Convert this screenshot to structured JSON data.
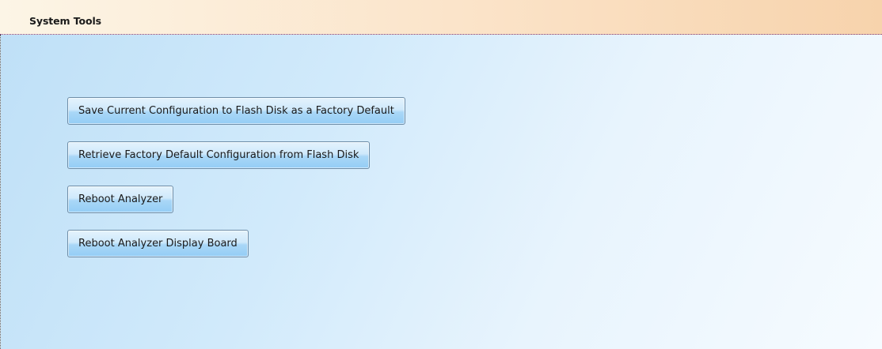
{
  "header": {
    "title": "System Tools"
  },
  "actions": {
    "save_config": "Save Current Configuration to Flash Disk as a Factory Default",
    "retrieve_config": "Retrieve Factory Default Configuration from Flash Disk",
    "reboot_analyzer": "Reboot Analyzer",
    "reboot_display_board": "Reboot Analyzer Display Board"
  }
}
